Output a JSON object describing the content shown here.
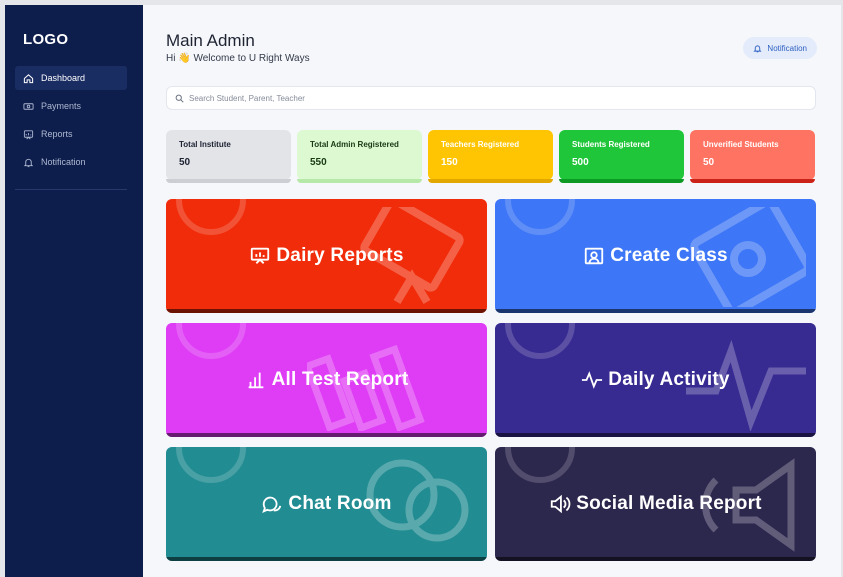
{
  "sidebar": {
    "logo": "LOGO",
    "items": [
      {
        "label": "Dashboard",
        "icon": "home-icon",
        "active": true
      },
      {
        "label": "Payments",
        "icon": "money-icon",
        "active": false
      },
      {
        "label": "Reports",
        "icon": "report-icon",
        "active": false
      },
      {
        "label": "Notification",
        "icon": "bell-icon",
        "active": false
      }
    ]
  },
  "header": {
    "title": "Main Admin",
    "greeting": "Hi 👋 Welcome to U Right Ways",
    "notification_label": "Notification"
  },
  "search": {
    "placeholder": "Search Student, Parent, Teacher",
    "value": ""
  },
  "stats": [
    {
      "label": "Total Institute",
      "value": "50",
      "color": "#e3e4e8"
    },
    {
      "label": "Total Admin Registered",
      "value": "550",
      "color": "#dcf9d2"
    },
    {
      "label": "Teachers Registered",
      "value": "150",
      "color": "#ffc502"
    },
    {
      "label": "Students Registered",
      "value": "500",
      "color": "#20c63a"
    },
    {
      "label": "Unverified Students",
      "value": "50",
      "color": "#ff7362"
    }
  ],
  "tiles": [
    {
      "label": "Dairy Reports",
      "icon": "presentation-icon",
      "color": "#f02c0a"
    },
    {
      "label": "Create Class",
      "icon": "classroom-icon",
      "color": "#3d76f6"
    },
    {
      "label": "All Test Report",
      "icon": "bar-chart-icon",
      "color": "#df3cf5"
    },
    {
      "label": "Daily Activity",
      "icon": "activity-icon",
      "color": "#372a91"
    },
    {
      "label": "Chat Room",
      "icon": "chat-icon",
      "color": "#218c92"
    },
    {
      "label": "Social Media Report",
      "icon": "megaphone-icon",
      "color": "#2c274d"
    }
  ]
}
